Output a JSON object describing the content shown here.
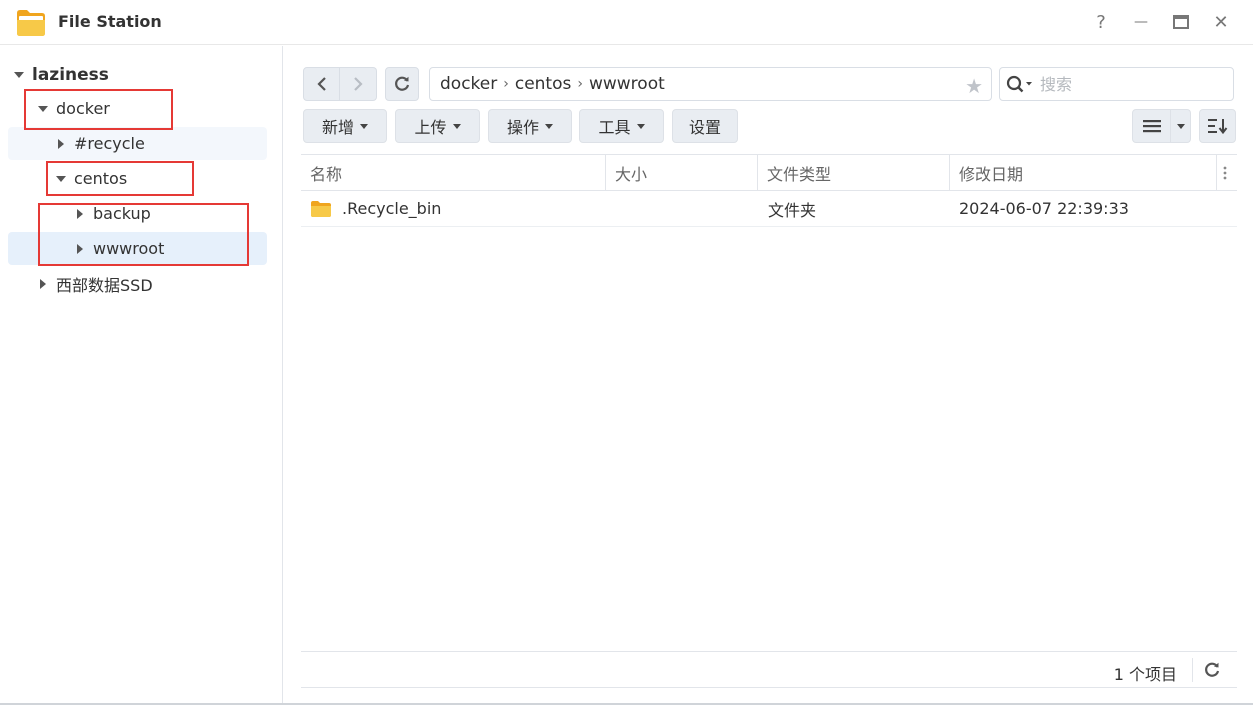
{
  "window": {
    "title": "File Station",
    "controls": {
      "help": "?",
      "minimize": "—",
      "maximize": "▭",
      "close": "✕"
    }
  },
  "sidebar": {
    "root": "laziness",
    "items": [
      {
        "label": "docker",
        "expanded": true
      },
      {
        "label": "#recycle",
        "expanded": false
      },
      {
        "label": "centos",
        "expanded": true
      },
      {
        "label": "backup",
        "expanded": false
      },
      {
        "label": "wwwroot",
        "expanded": false,
        "selected": true
      },
      {
        "label": "西部数据SSD",
        "expanded": false
      }
    ]
  },
  "path": {
    "segments": [
      "docker",
      "centos",
      "wwwroot"
    ],
    "separator": "›"
  },
  "search": {
    "placeholder": "搜索"
  },
  "toolbar": {
    "new_label": "新增",
    "upload_label": "上传",
    "action_label": "操作",
    "tools_label": "工具",
    "settings_label": "设置"
  },
  "table": {
    "columns": [
      "名称",
      "大小",
      "文件类型",
      "修改日期"
    ],
    "rows": [
      {
        "name": ".Recycle_bin",
        "size": "",
        "type": "文件夹",
        "modified": "2024-06-07 22:39:33"
      }
    ]
  },
  "footer": {
    "count": "1 个项目"
  },
  "colors": {
    "highlight_box": "#e53935",
    "selected_row": "#e6f0fb",
    "button_bg": "#e9edf2",
    "folder_yellow": "#f7c948"
  }
}
